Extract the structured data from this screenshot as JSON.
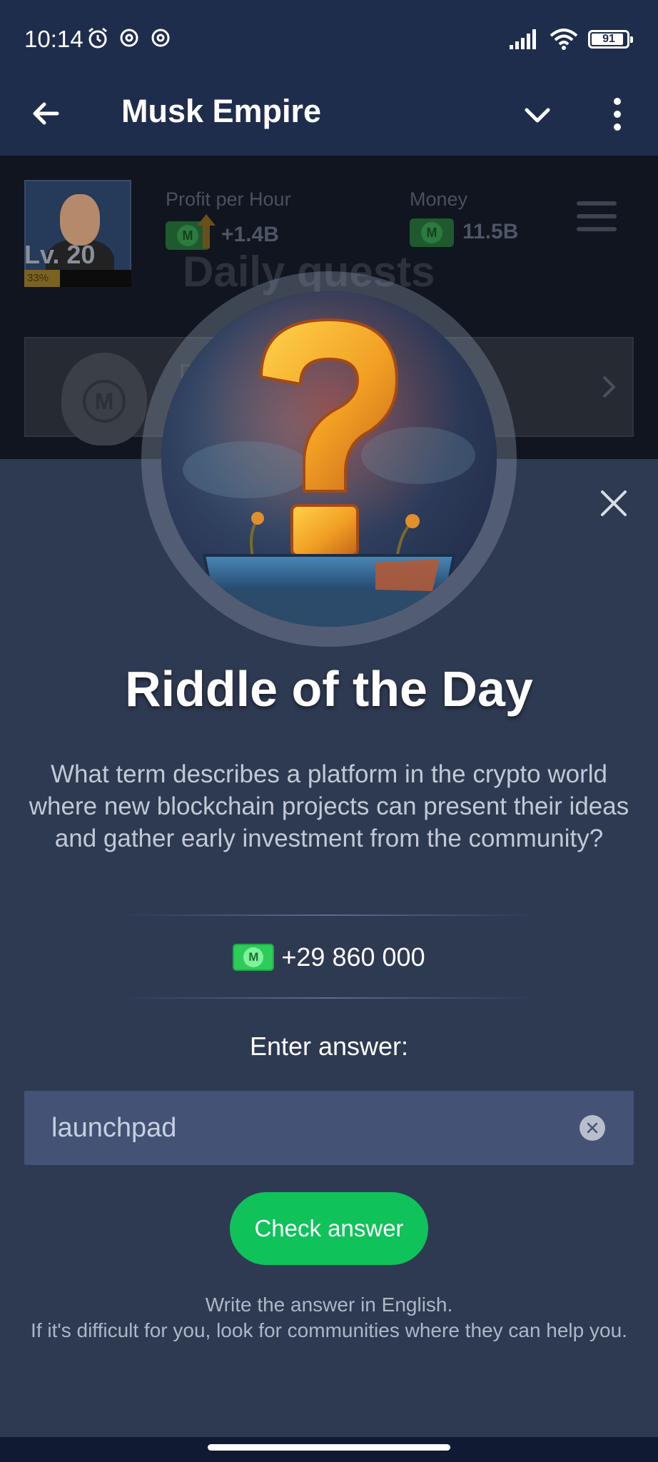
{
  "status_bar": {
    "time": "10:14",
    "battery": "91",
    "icons": [
      "alarm-icon",
      "threads-icon",
      "threads-icon",
      "signal-icon",
      "wifi-icon",
      "battery-icon"
    ]
  },
  "app_bar": {
    "title": "Musk Empire",
    "icons": [
      "back-arrow-icon",
      "chevron-down-icon",
      "more-vertical-icon"
    ]
  },
  "game": {
    "level": "Lv. 20",
    "level_progress_text": "33%",
    "level_progress": 0.33,
    "profit_label": "Profit per Hour",
    "profit_value": "+1.4B",
    "money_label": "Money",
    "money_value": "11.5B",
    "section_title": "Daily quests",
    "quest_initial": "D",
    "coin_letter": "M"
  },
  "modal": {
    "title": "Riddle of the Day",
    "question": "What term describes a platform in the crypto world where new blockchain projects can present their ideas and gather early investment from the community?",
    "reward": "+29 860 000",
    "reward_coin_letter": "M",
    "enter_label": "Enter answer:",
    "answer_value": "launchpad",
    "check_button": "Check answer",
    "hint_line1": "Write the answer in English.",
    "hint_line2": "If it's difficult for you, look for communities where they can help you."
  },
  "colors": {
    "header_bg": "#1f2d4d",
    "modal_bg": "#2e3a52",
    "input_bg": "#435275",
    "button_green": "#0fc25a",
    "coin_green": "#2ecc5a"
  }
}
